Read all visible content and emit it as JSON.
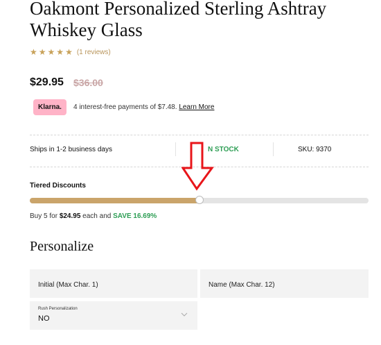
{
  "product": {
    "title": "Oakmont Personalized Sterling Ashtray Whiskey Glass",
    "rating": 5,
    "reviews": "(1 reviews)",
    "price": "$29.95",
    "old_price": "$36.00"
  },
  "klarna": {
    "badge": "Klarna.",
    "text": "4 interest-free payments of $7.48.",
    "link": "Learn More",
    "badge_color": "#ffb3c7"
  },
  "shipping": {
    "ships": "Ships in 1-2 business days",
    "stock": "N STOCK",
    "sku": "SKU: 9370"
  },
  "tiered": {
    "label": "Tiered Discounts",
    "progress": 0.5,
    "buy_prefix": "Buy 5 for ",
    "buy_price": "$24.95",
    "buy_mid": " each and ",
    "save": "SAVE 16.69%"
  },
  "personalize": {
    "title": "Personalize",
    "initial_placeholder": "Initial (Max Char. 1)",
    "name_placeholder": "Name (Max Char. 12)",
    "rush_label": "Rush Personalization",
    "rush_value": "NO"
  },
  "colors": {
    "accent_gold": "#caa46a",
    "star_gold": "#c8a25a",
    "stock_green": "#2e9e55",
    "annotation_red": "#e8151a"
  },
  "icons": [
    "star-icon",
    "chevron-down-icon",
    "down-arrow-annotation-icon"
  ]
}
